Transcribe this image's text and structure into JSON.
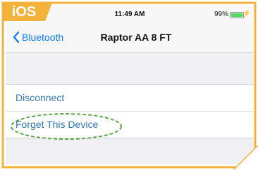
{
  "badge": {
    "label": "iOS"
  },
  "status_bar": {
    "time": "11:49 AM",
    "battery_percent": "99%",
    "battery_level": 0.99
  },
  "nav": {
    "back_label": "Bluetooth",
    "title": "Raptor AA 8 FT"
  },
  "device_actions": [
    {
      "label": "Disconnect"
    },
    {
      "label": "Forget This Device"
    }
  ],
  "colors": {
    "badge": "#f3b23a",
    "link_blue": "#3277b7",
    "ios_blue": "#0a7aff",
    "highlight_green": "#5aa845",
    "background": "#efeff4"
  }
}
